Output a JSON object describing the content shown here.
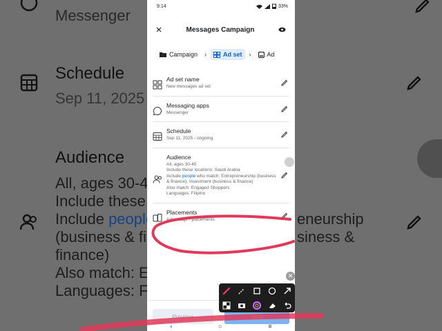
{
  "status": {
    "time": "9:14",
    "battery": "33%"
  },
  "header": {
    "title": "Messages Campaign"
  },
  "breadcrumbs": [
    {
      "label": "Campaign",
      "active": false
    },
    {
      "label": "Ad set",
      "active": true
    },
    {
      "label": "Ad",
      "active": false
    }
  ],
  "items": [
    {
      "title": "Ad set name",
      "sub": "New messages ad set"
    },
    {
      "title": "Messaging apps",
      "sub": "Messenger"
    },
    {
      "title": "Schedule",
      "sub": "Sep 11, 2025 - ongoing"
    },
    {
      "title": "Audience",
      "lines": {
        "l1": "All, ages 30-45",
        "l2": "Include these locations: Saudi Arabia",
        "l3a": "Include ",
        "l3link": "people",
        "l3b": " who match: Entrepreneurship (business & finance), Investment (business & finance)",
        "l4": "Also match: Engaged Shoppers",
        "l5": "Languages: Filipino"
      }
    },
    {
      "title": "Placements",
      "sub": "Advantage+ placements"
    }
  ],
  "footer": {
    "previous": "Previous",
    "next": "Next"
  },
  "background": {
    "messenger": "Messenger",
    "schedule": "Schedule",
    "schedule_date": "Sep 11, 2025",
    "audience": "Audience",
    "aud1": "All, ages 30-4",
    "aud2": "Include these l",
    "aud3a": "Include ",
    "aud3link": "people",
    "aud4": "(business & fin",
    "aud5": "finance)",
    "aud6": "Also match: Er",
    "aud7": "Languages: Fili",
    "right1": "eneurship",
    "right2": "siness &"
  },
  "colors": {
    "accent": "#0a66d8",
    "annotation": "#e0395a"
  }
}
